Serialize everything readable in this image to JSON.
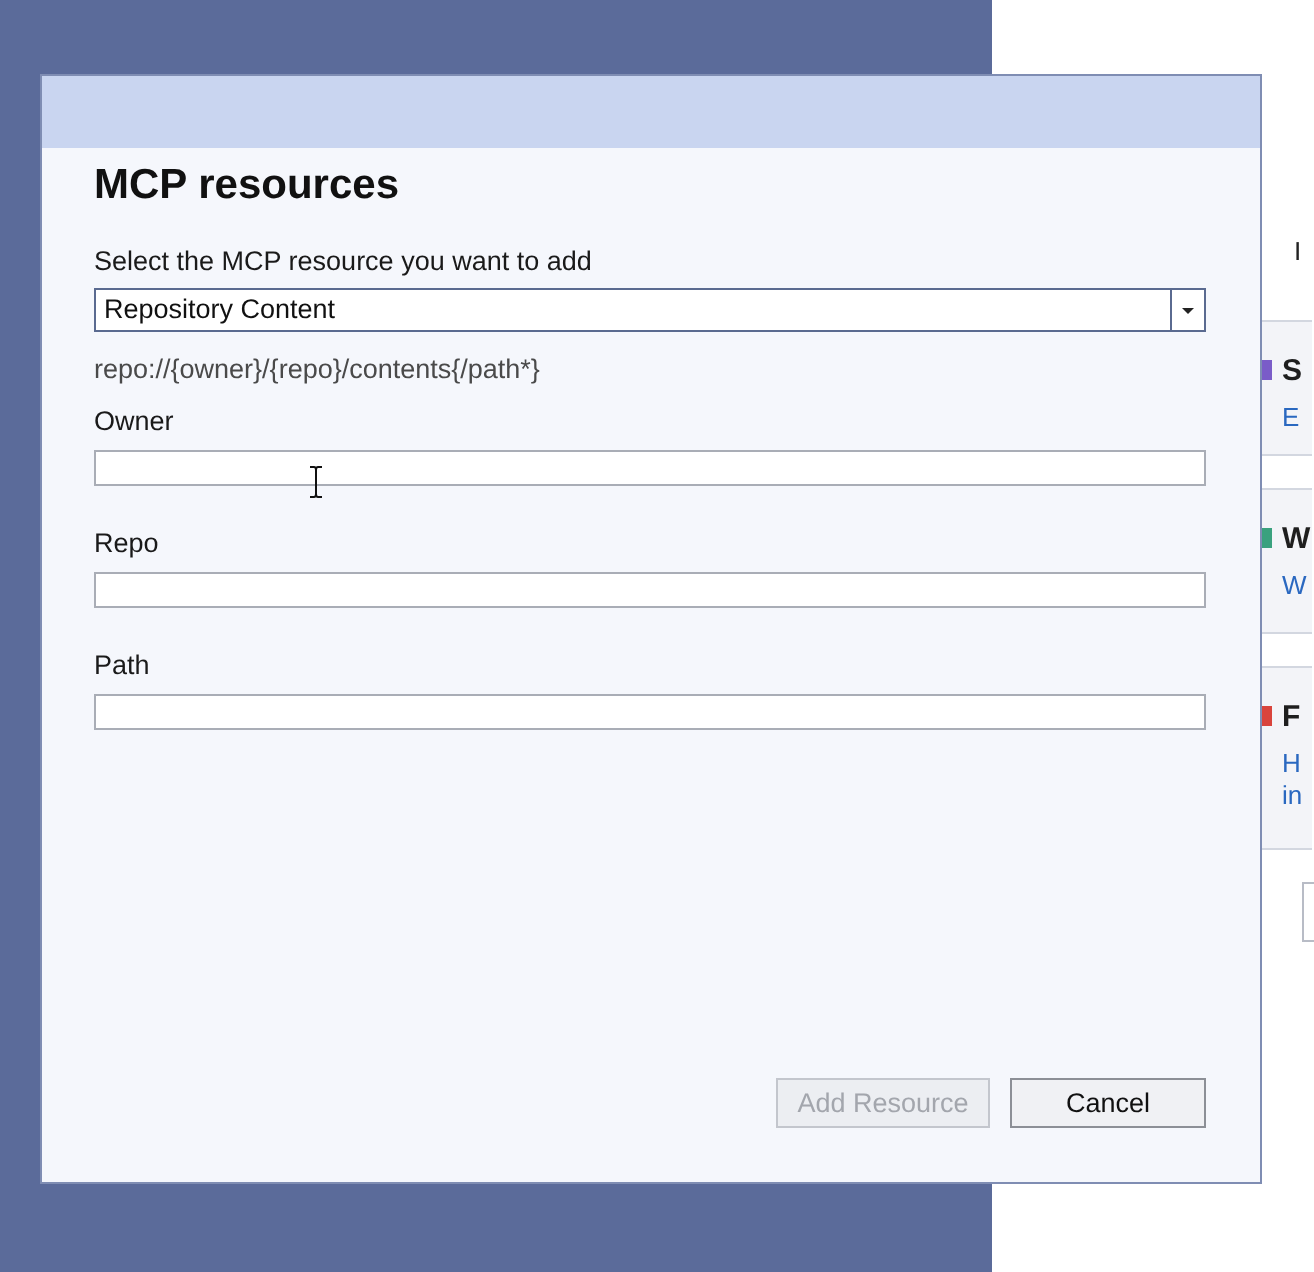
{
  "background_app": {
    "heading_fragment": "I",
    "cards": [
      {
        "title": "S",
        "link_lines": [
          "E"
        ],
        "color": "#7a5cc8"
      },
      {
        "title": "W",
        "link_lines": [
          "W"
        ],
        "color": "#3aa17e"
      },
      {
        "title": "F",
        "link_lines": [
          "H",
          "in"
        ],
        "color": "#d9443c"
      }
    ]
  },
  "dialog": {
    "heading": "MCP resources",
    "select_label": "Select the MCP resource you want to add",
    "dropdown": {
      "value": "Repository Content"
    },
    "uri_template": "repo://{owner}/{repo}/contents{/path*}",
    "fields": [
      {
        "label": "Owner"
      },
      {
        "label": "Repo"
      },
      {
        "label": "Path"
      }
    ],
    "buttons": [
      {
        "label": "Add Resource",
        "disabled": true
      },
      {
        "label": "Cancel",
        "disabled": false
      }
    ]
  }
}
